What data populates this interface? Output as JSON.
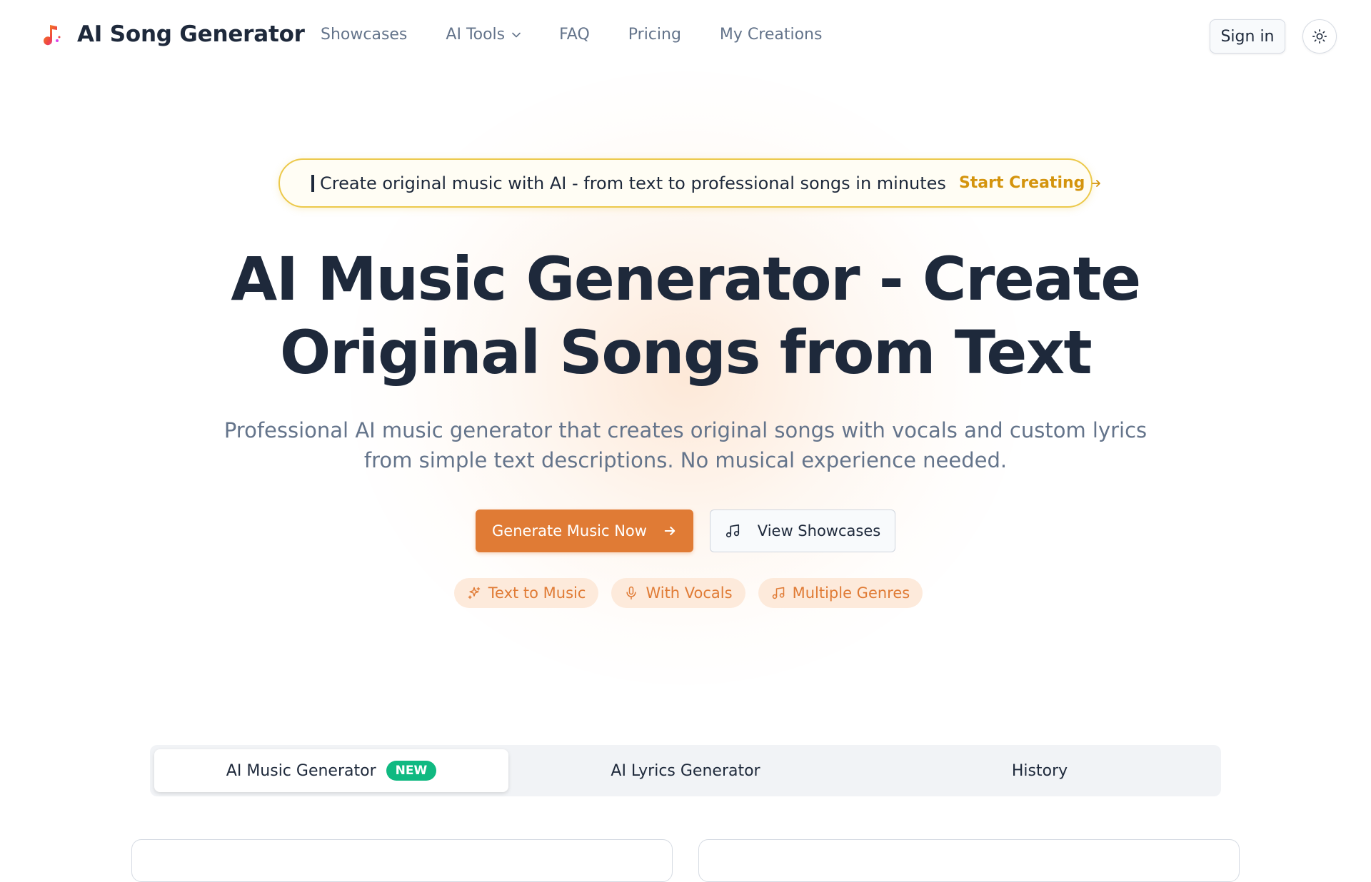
{
  "header": {
    "brand": "AI Song Generator",
    "nav": [
      {
        "label": "Showcases"
      },
      {
        "label": "AI Tools",
        "has_dropdown": true
      },
      {
        "label": "FAQ"
      },
      {
        "label": "Pricing"
      },
      {
        "label": "My Creations"
      }
    ],
    "signin_label": "Sign in",
    "theme_icon": "sun-icon"
  },
  "announcement": {
    "icon": "trophy-icon",
    "message": "Create original music with AI - from text to professional songs in minutes",
    "cta_label": "Start Creating"
  },
  "hero": {
    "title_line1": "AI Music Generator - Create",
    "title_line2": "Original Songs from Text",
    "subtitle_line1": "Professional AI music generator that creates original songs with vocals and custom lyrics",
    "subtitle_line2": "from simple text descriptions. No musical experience needed.",
    "primary_button": "Generate Music Now",
    "secondary_button": "View Showcases",
    "chips": [
      {
        "label": "Text to Music",
        "icon": "sparkles-icon"
      },
      {
        "label": "With Vocals",
        "icon": "microphone-icon"
      },
      {
        "label": "Multiple Genres",
        "icon": "music-note-icon"
      }
    ]
  },
  "tabs": [
    {
      "label": "AI Music Generator",
      "badge": "NEW",
      "active": true
    },
    {
      "label": "AI Lyrics Generator",
      "active": false
    },
    {
      "label": "History",
      "active": false
    }
  ],
  "colors": {
    "accent": "#e07b35",
    "accent_soft": "#fdeadb",
    "announce_border": "#ecc94b",
    "announce_cta": "#d4940d",
    "badge_green": "#10b981",
    "text_dark": "#1e293b",
    "text_muted": "#64748b"
  }
}
